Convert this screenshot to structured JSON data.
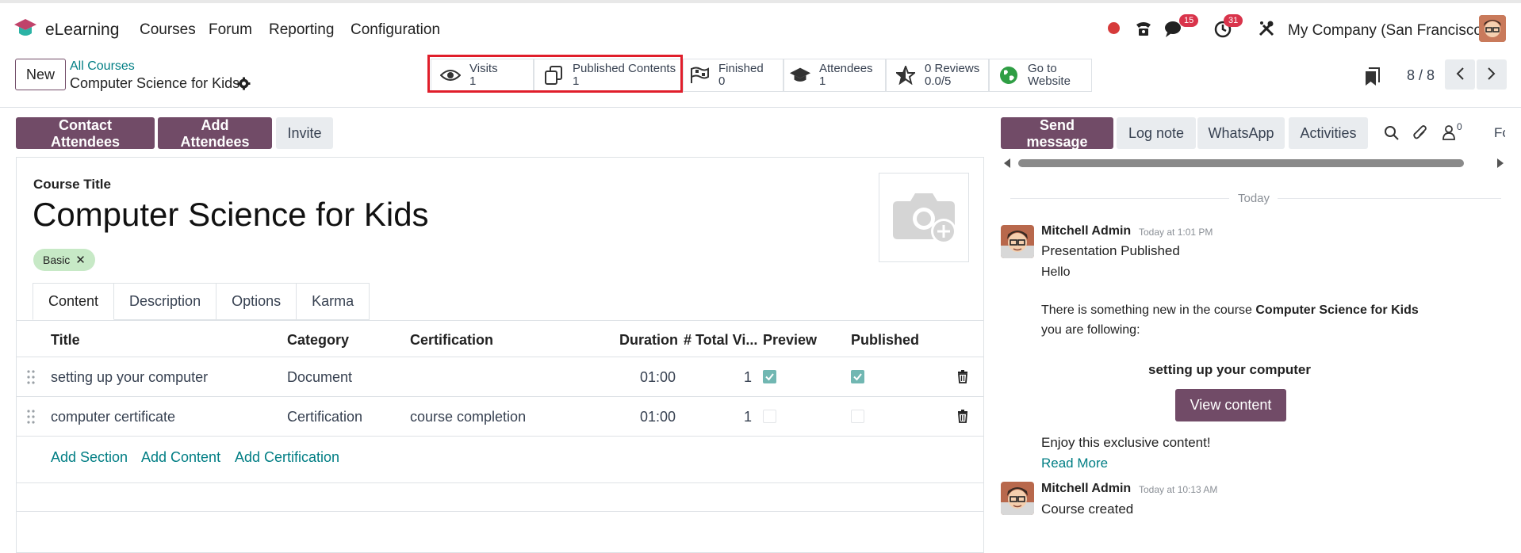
{
  "nav": {
    "app_name": "eLearning",
    "menu": [
      "Courses",
      "Forum",
      "Reporting",
      "Configuration"
    ],
    "messages_count": "15",
    "activities_count": "31",
    "company": "My Company (San Francisco)"
  },
  "control_panel": {
    "new_label": "New",
    "breadcrumb_parent": "All Courses",
    "breadcrumb_current": "Computer Science for Kids",
    "pager": "8 / 8"
  },
  "stat_buttons": [
    {
      "label": "Visits",
      "value": "1",
      "icon": "eye-icon"
    },
    {
      "label": "Published Contents",
      "value": "1",
      "icon": "copy-icon"
    },
    {
      "label": "Finished",
      "value": "0",
      "icon": "flag-checkered-icon"
    },
    {
      "label": "Attendees",
      "value": "1",
      "icon": "graduation-cap-icon"
    },
    {
      "label": "0 Reviews",
      "value": "0.0/5",
      "icon": "star-icon"
    },
    {
      "label": "Go to",
      "value": "Website",
      "icon": "globe-icon"
    }
  ],
  "actions": {
    "contact": "Contact Attendees",
    "add": "Add Attendees",
    "invite": "Invite"
  },
  "form": {
    "title_label": "Course Title",
    "title": "Computer Science for Kids",
    "tag": "Basic",
    "tabs": [
      "Content",
      "Description",
      "Options",
      "Karma"
    ],
    "columns": [
      "Title",
      "Category",
      "Certification",
      "Duration",
      "# Total Vi...",
      "Preview",
      "Published"
    ],
    "rows": [
      {
        "title": "setting up your computer",
        "category": "Document",
        "certification": "",
        "duration": "01:00",
        "views": "1",
        "preview": true,
        "published": true
      },
      {
        "title": "computer certificate",
        "category": "Certification",
        "certification": "course completion",
        "duration": "01:00",
        "views": "1",
        "preview": false,
        "published": false
      }
    ],
    "add_section": "Add Section",
    "add_content": "Add Content",
    "add_certification": "Add Certification"
  },
  "chatter": {
    "send_message": "Send message",
    "log_note": "Log note",
    "whatsapp": "WhatsApp",
    "activities": "Activities",
    "followers_count": "0",
    "follow_cut": "Fc",
    "date_separator": "Today",
    "messages": [
      {
        "author": "Mitchell Admin",
        "time": "Today at 1:01 PM",
        "subject": "Presentation Published",
        "greeting": "Hello",
        "body_line1_prefix": "There is something new in the course ",
        "body_line1_bold": "Computer Science for Kids",
        "body_line2": "you are following:",
        "content_title": "setting up your computer",
        "button": "View content",
        "footer": "Enjoy this exclusive content!",
        "read_more": "Read More"
      },
      {
        "author": "Mitchell Admin",
        "time": "Today at 10:13 AM",
        "subject": "Course created"
      }
    ]
  },
  "colors": {
    "brand": "#714b67",
    "link": "#017e84",
    "highlight_box": "#e01e2b",
    "badge": "#d9344b"
  }
}
